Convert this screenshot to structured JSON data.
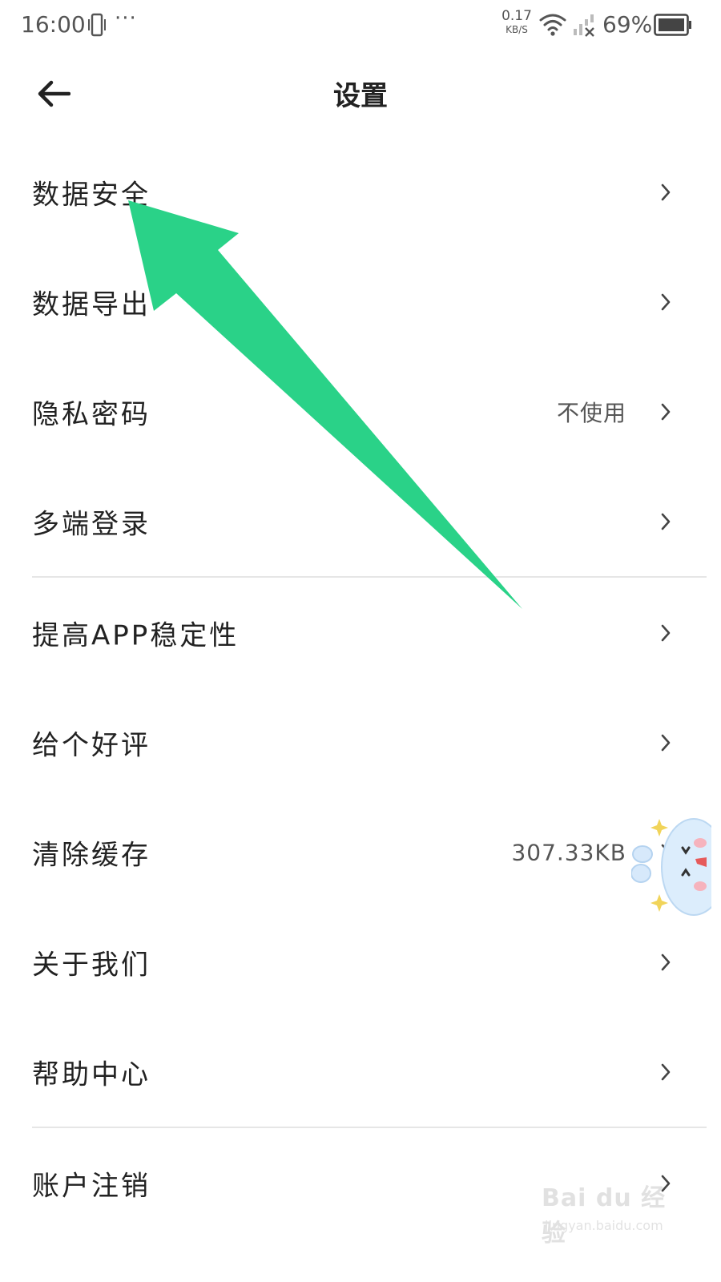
{
  "status_bar": {
    "time": "16:00",
    "more_dots": "···",
    "net_speed_value": "0.17",
    "net_speed_unit": "KB/S",
    "battery_percent": "69%",
    "icons": [
      "vibrate-icon",
      "wifi-icon",
      "signal-icon",
      "battery-icon"
    ]
  },
  "header": {
    "title": "设置",
    "back_icon": "arrow-left-icon"
  },
  "items": [
    {
      "label": "数据安全",
      "value": ""
    },
    {
      "label": "数据导出",
      "value": ""
    },
    {
      "label": "隐私密码",
      "value": "不使用"
    },
    {
      "label": "多端登录",
      "value": ""
    },
    {
      "label": "提高APP稳定性",
      "value": ""
    },
    {
      "label": "给个好评",
      "value": ""
    },
    {
      "label": "清除缓存",
      "value": "307.33KB"
    },
    {
      "label": "关于我们",
      "value": ""
    },
    {
      "label": "帮助中心",
      "value": ""
    },
    {
      "label": "账户注销",
      "value": ""
    }
  ],
  "watermark": {
    "brand": "Bai du 经验",
    "url": "jingyan.baidu.com"
  },
  "colors": {
    "annotation_arrow": "#2ad288",
    "divider": "#e6e6e6",
    "text": "#222222",
    "secondary_text": "#555555"
  }
}
